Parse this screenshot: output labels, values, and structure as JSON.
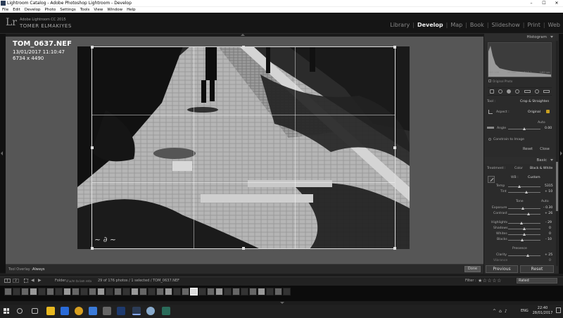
{
  "window": {
    "title": "Lightroom Catalog - Adobe Photoshop Lightroom - Develop",
    "controls": [
      "–",
      "☐",
      "✕"
    ]
  },
  "menubar": [
    "File",
    "Edit",
    "Develop",
    "Photo",
    "Settings",
    "Tools",
    "View",
    "Window",
    "Help"
  ],
  "identity": {
    "logo": "Lr",
    "product": "Adobe Lightroom CC 2015",
    "owner": "TOMER ELMAKIYES"
  },
  "modules": [
    "Library",
    "Develop",
    "Map",
    "Book",
    "Slideshow",
    "Print",
    "Web"
  ],
  "active_module": "Develop",
  "photo_info": {
    "filename": "TOM_0637.NEF",
    "datetime": "13/01/2017 11:10:47",
    "dimensions": "6734 x 4490"
  },
  "toolbar": {
    "tool_overlay_label": "Tool Overlay :",
    "tool_overlay_value": "Always",
    "done_label": "Done"
  },
  "panels": {
    "histogram_title": "Histogram",
    "histogram_info": [
      "ISO 100",
      "35 mm",
      "f / 7.1",
      "1/60 sec"
    ],
    "original_photo": "Original Photo",
    "crop": {
      "tool_label": "Tool :",
      "tool_value": "Crop & Straighten",
      "aspect_label": "Aspect :",
      "aspect_value": "Original",
      "angle_label": "Angle",
      "angle_value": "0.00",
      "auto": "Auto",
      "constrain": "Constrain to Image",
      "reset": "Reset",
      "close": "Close"
    },
    "basic": {
      "title": "Basic",
      "treatment_label": "Treatment :",
      "color": "Color",
      "bw": "Black & White",
      "wb_label": "WB :",
      "wb_value": "Custom",
      "temp_label": "Temp",
      "temp_value": "5315",
      "tint_label": "Tint",
      "tint_value": "+ 10",
      "tone_label": "Tone",
      "tone_auto": "Auto",
      "exposure_label": "Exposure",
      "exposure_value": "- 0.30",
      "contrast_label": "Contrast",
      "contrast_value": "+ 26",
      "highlights_label": "Highlights",
      "highlights_value": "- 29",
      "shadows_label": "Shadows",
      "shadows_value": "0",
      "whites_label": "Whites",
      "whites_value": "0",
      "blacks_label": "Blacks",
      "blacks_value": "- 10",
      "presence_label": "Presence",
      "clarity_label": "Clarity",
      "clarity_value": "+ 25",
      "vibrance_label": "Vibrance",
      "vibrance_value": "0"
    },
    "previous": "Previous",
    "reset": "Reset"
  },
  "filmbar": {
    "page1": "1",
    "page2": "2",
    "nav_prev": "◀",
    "nav_next": "▶",
    "folder_label": "Folder :",
    "folder_path": "s:\\u/m ta lam reta",
    "photo_count": "29 of 176 photos / 1 selected / TOM_0637.NEF",
    "filter_label": "Filter :",
    "stars": "★☆☆☆☆",
    "rated": "Rated"
  },
  "taskbar": {
    "time": "22:40",
    "date": "28/01/2017",
    "lang": "ENG"
  },
  "colors": {
    "lock_accent": "#c9a020",
    "panel_bg": "#2b2b2b",
    "canvas_bg": "#565656"
  }
}
